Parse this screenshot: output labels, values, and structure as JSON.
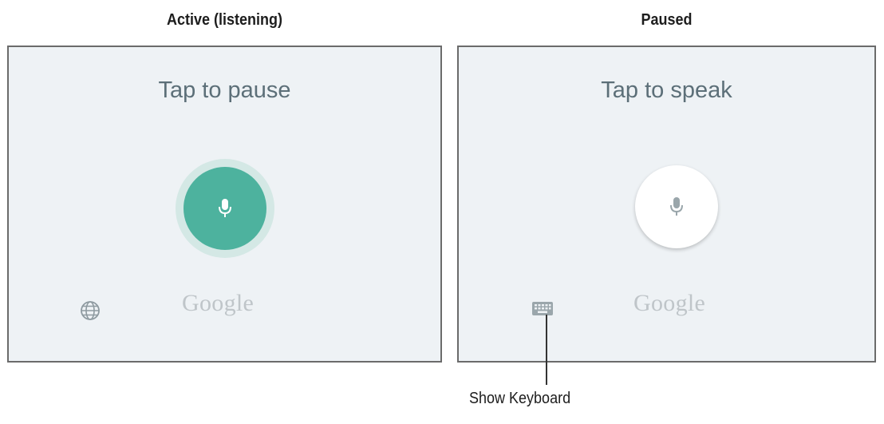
{
  "panels": {
    "active": {
      "caption": "Active (listening)",
      "prompt": "Tap to pause",
      "brand": "Google",
      "mic_icon": "microphone-icon",
      "corner_icon": "globe-icon"
    },
    "paused": {
      "caption": "Paused",
      "prompt": "Tap to speak",
      "brand": "Google",
      "mic_icon": "microphone-icon",
      "corner_icon": "keyboard-icon"
    }
  },
  "callout": {
    "label": "Show Keyboard"
  },
  "colors": {
    "panel_bg": "#eef2f5",
    "mic_active": "#4db29e",
    "mic_halo": "#d4e8e5",
    "prompt_text": "#5c6f78",
    "brand_text": "#bfc5c9"
  }
}
